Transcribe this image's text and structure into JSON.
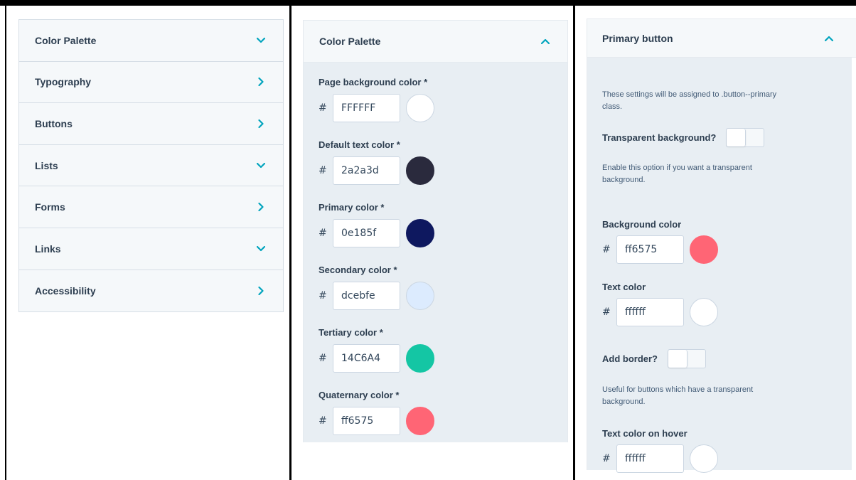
{
  "panel1": {
    "items": [
      {
        "label": "Color Palette",
        "icon": "chevron-down-icon"
      },
      {
        "label": "Typography",
        "icon": "chevron-right-icon"
      },
      {
        "label": "Buttons",
        "icon": "chevron-right-icon"
      },
      {
        "label": "Lists",
        "icon": "chevron-down-icon"
      },
      {
        "label": "Forms",
        "icon": "chevron-right-icon"
      },
      {
        "label": "Links",
        "icon": "chevron-down-icon"
      },
      {
        "label": "Accessibility",
        "icon": "chevron-right-icon"
      }
    ]
  },
  "panel2": {
    "title": "Color Palette",
    "icon": "chevron-up-icon",
    "fields": [
      {
        "label": "Page background color *",
        "hash": "#",
        "value": "FFFFFF",
        "swatch": "#ffffff"
      },
      {
        "label": "Default text color *",
        "hash": "#",
        "value": "2a2a3d",
        "swatch": "#2a2a3d"
      },
      {
        "label": "Primary color *",
        "hash": "#",
        "value": "0e185f",
        "swatch": "#0e185f"
      },
      {
        "label": "Secondary color *",
        "hash": "#",
        "value": "dcebfe",
        "swatch": "#dcebfe"
      },
      {
        "label": "Tertiary color *",
        "hash": "#",
        "value": "14C6A4",
        "swatch": "#14c6a4"
      },
      {
        "label": "Quaternary color *",
        "hash": "#",
        "value": "ff6575",
        "swatch": "#ff6575"
      }
    ]
  },
  "panel3": {
    "title": "Primary button",
    "icon": "chevron-up-icon",
    "intro_line1": "These settings will be assigned to .button--primary",
    "intro_line2": "class.",
    "transparent_label": "Transparent background?",
    "transparent_on": false,
    "transparent_help_line1": "Enable this option if you want a transparent",
    "transparent_help_line2": "background.",
    "bg_label": "Background color",
    "bg_value": "ff6575",
    "bg_swatch": "#ff6575",
    "text_label": "Text color",
    "text_value": "ffffff",
    "text_swatch": "#ffffff",
    "border_label": "Add border?",
    "border_on": false,
    "border_help_line1": "Useful for buttons which have a transparent",
    "border_help_line2": "background.",
    "hover_label": "Text color on hover",
    "hover_value": "ffffff",
    "hover_swatch": "#ffffff",
    "hash": "#"
  },
  "colors": {
    "accent": "#00a4bd",
    "frame": "#000000"
  }
}
